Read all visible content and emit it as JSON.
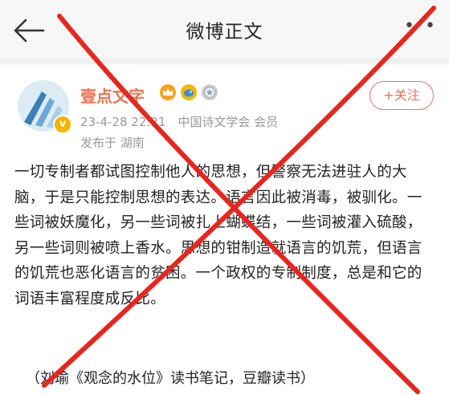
{
  "header": {
    "title": "微博正文",
    "more_label": "• •"
  },
  "post": {
    "author": {
      "name": "壹点文字",
      "verified_mark": "v"
    },
    "meta": {
      "time": "23-4-28 22:21",
      "source": "中国诗文学会 会员",
      "location": "发布于 湖南"
    },
    "follow_label": "+关注",
    "content": "一切专制者都试图控制他人的思想，但警察无法进驻人的大脑，于是只能控制思想的表达。语言因此被消毒，被驯化。一些词被妖魔化，另一些词被扎上蝴蝶结，一些词被灌入硫酸，另一些词则被喷上香水。思想的钳制造就语言的饥荒，但语言的饥荒也恶化语言的贫困。一个政权的专制制度，总是和它的词语丰富程度成反比。",
    "citation": "（刘瑜《观念的水位》读书笔记，豆瓣读书）"
  },
  "colors": {
    "accent": "#eb7350",
    "meta_gray": "#9a9a9a",
    "cross_red": "#e8261d"
  },
  "icons": {
    "back": "arrow-left-icon",
    "badges": [
      "crown-badge-icon",
      "blue-bird-badge-icon",
      "silver-medal-badge-icon"
    ]
  }
}
